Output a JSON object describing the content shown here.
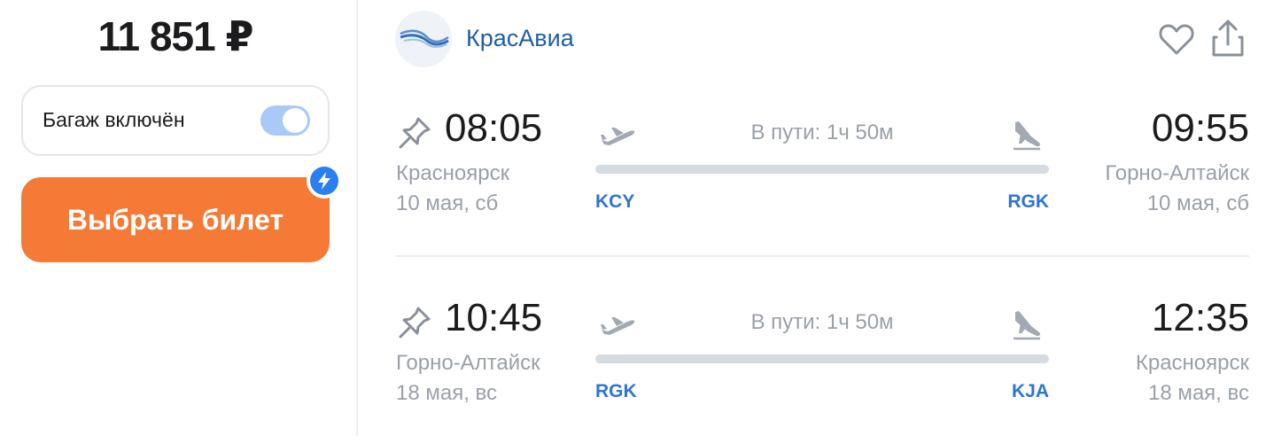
{
  "price": {
    "value": "11 851 ₽"
  },
  "baggage": {
    "label": "Багаж включён",
    "enabled": true
  },
  "select_button": {
    "label": "Выбрать билет"
  },
  "airline": {
    "name": "КрасАвиа"
  },
  "segments": [
    {
      "dep_time": "08:05",
      "dep_city": "Красноярск",
      "dep_date": "10 мая, сб",
      "duration": "В пути: 1ч 50м",
      "from_code": "KCY",
      "to_code": "RGK",
      "arr_time": "09:55",
      "arr_city": "Горно-Алтайск",
      "arr_date": "10 мая, сб"
    },
    {
      "dep_time": "10:45",
      "dep_city": "Горно-Алтайск",
      "dep_date": "18 мая, вс",
      "duration": "В пути: 1ч 50м",
      "from_code": "RGK",
      "to_code": "KJA",
      "arr_time": "12:35",
      "arr_city": "Красноярск",
      "arr_date": "18 мая, вс"
    }
  ],
  "colors": {
    "accent_orange": "#f47a36",
    "airline_blue": "#1f5fa2",
    "code_blue": "#2d74d8",
    "muted_gray": "#9aa0a8",
    "toggle_blue": "#a9c9f7"
  },
  "icons": [
    "lightning-icon",
    "airline-logo",
    "heart-icon",
    "share-icon",
    "pin-icon",
    "takeoff-icon",
    "landing-icon"
  ]
}
